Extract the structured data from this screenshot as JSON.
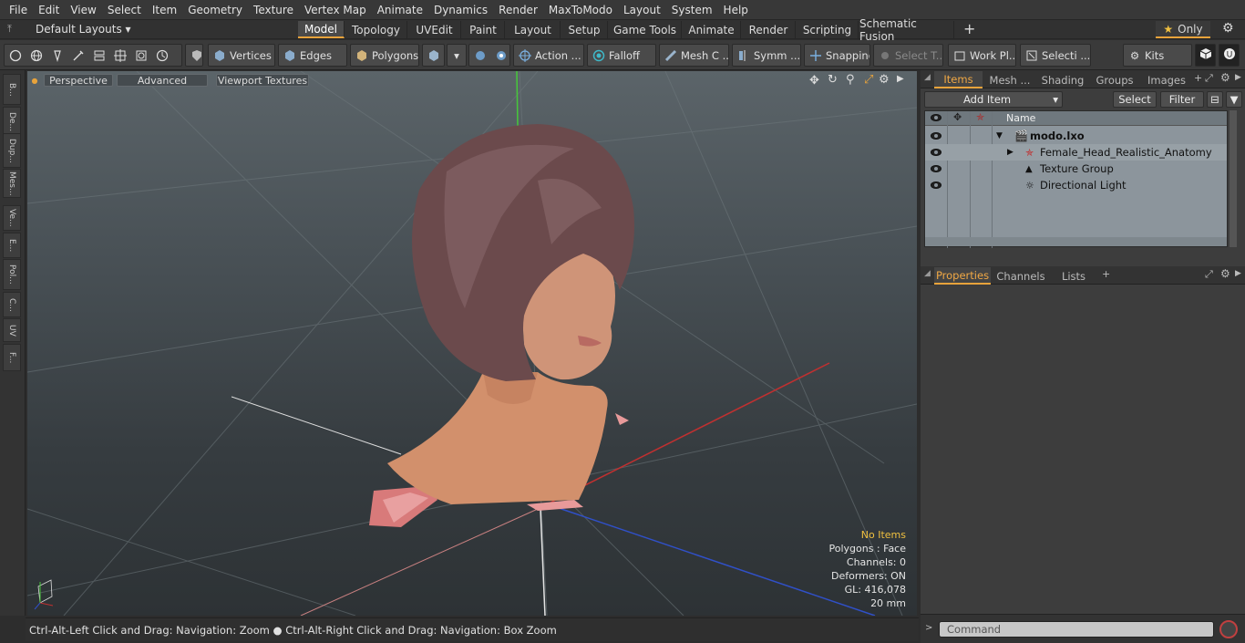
{
  "menu": [
    "File",
    "Edit",
    "View",
    "Select",
    "Item",
    "Geometry",
    "Texture",
    "Vertex Map",
    "Animate",
    "Dynamics",
    "Render",
    "MaxToModo",
    "Layout",
    "System",
    "Help"
  ],
  "layout_bar": {
    "layouts_label": "Default Layouts",
    "tabs": [
      "Model",
      "Topology",
      "UVEdit",
      "Paint",
      "Layout",
      "Setup",
      "Game Tools",
      "Animate",
      "Render",
      "Scripting",
      "Schematic Fusion"
    ],
    "active_tab": "Model",
    "only_label": "Only"
  },
  "toolbar": {
    "vertices": "Vertices",
    "edges": "Edges",
    "polygons": "Polygons",
    "action": "Action ...",
    "falloff": "Falloff",
    "mesh": "Mesh C ...",
    "symmetry": "Symm ...",
    "snapping": "Snapping",
    "select_t": "Select T...",
    "work_plane": "Work Pl...",
    "selection": "Selecti ...",
    "kits": "Kits"
  },
  "left_tabs": [
    "B...",
    "De...",
    "Dup...",
    "Mes...",
    "Ve...",
    "E...",
    "Pol...",
    "C...",
    "UV",
    "F..."
  ],
  "viewport": {
    "perspective": "Perspective",
    "advanced": "Advanced",
    "textures": "Viewport Textures",
    "hud": {
      "no_items": "No Items",
      "polygons": "Polygons : Face",
      "channels": "Channels: 0",
      "deformers": "Deformers: ON",
      "gl": "GL: 416,078",
      "scale": "20 mm"
    }
  },
  "status_bar": "Ctrl-Alt-Left Click and Drag: Navigation: Zoom ● Ctrl-Alt-Right Click and Drag: Navigation: Box Zoom",
  "items_panel": {
    "tabs": [
      "Items",
      "Mesh ...",
      "Shading",
      "Groups",
      "Images"
    ],
    "active_tab": "Items",
    "add_item": "Add Item",
    "select": "Select",
    "filter": "Filter",
    "column_name": "Name",
    "tree": [
      {
        "label": "modo.lxo",
        "bold": true
      },
      {
        "label": "Female_Head_Realistic_Anatomy"
      },
      {
        "label": "Texture Group"
      },
      {
        "label": "Directional Light"
      }
    ]
  },
  "properties_panel": {
    "tabs": [
      "Properties",
      "Channels",
      "Lists"
    ],
    "active_tab": "Properties"
  },
  "command_placeholder": "Command",
  "colors": {
    "accent": "#e8a33b",
    "hud_highlight": "#f0c040"
  }
}
